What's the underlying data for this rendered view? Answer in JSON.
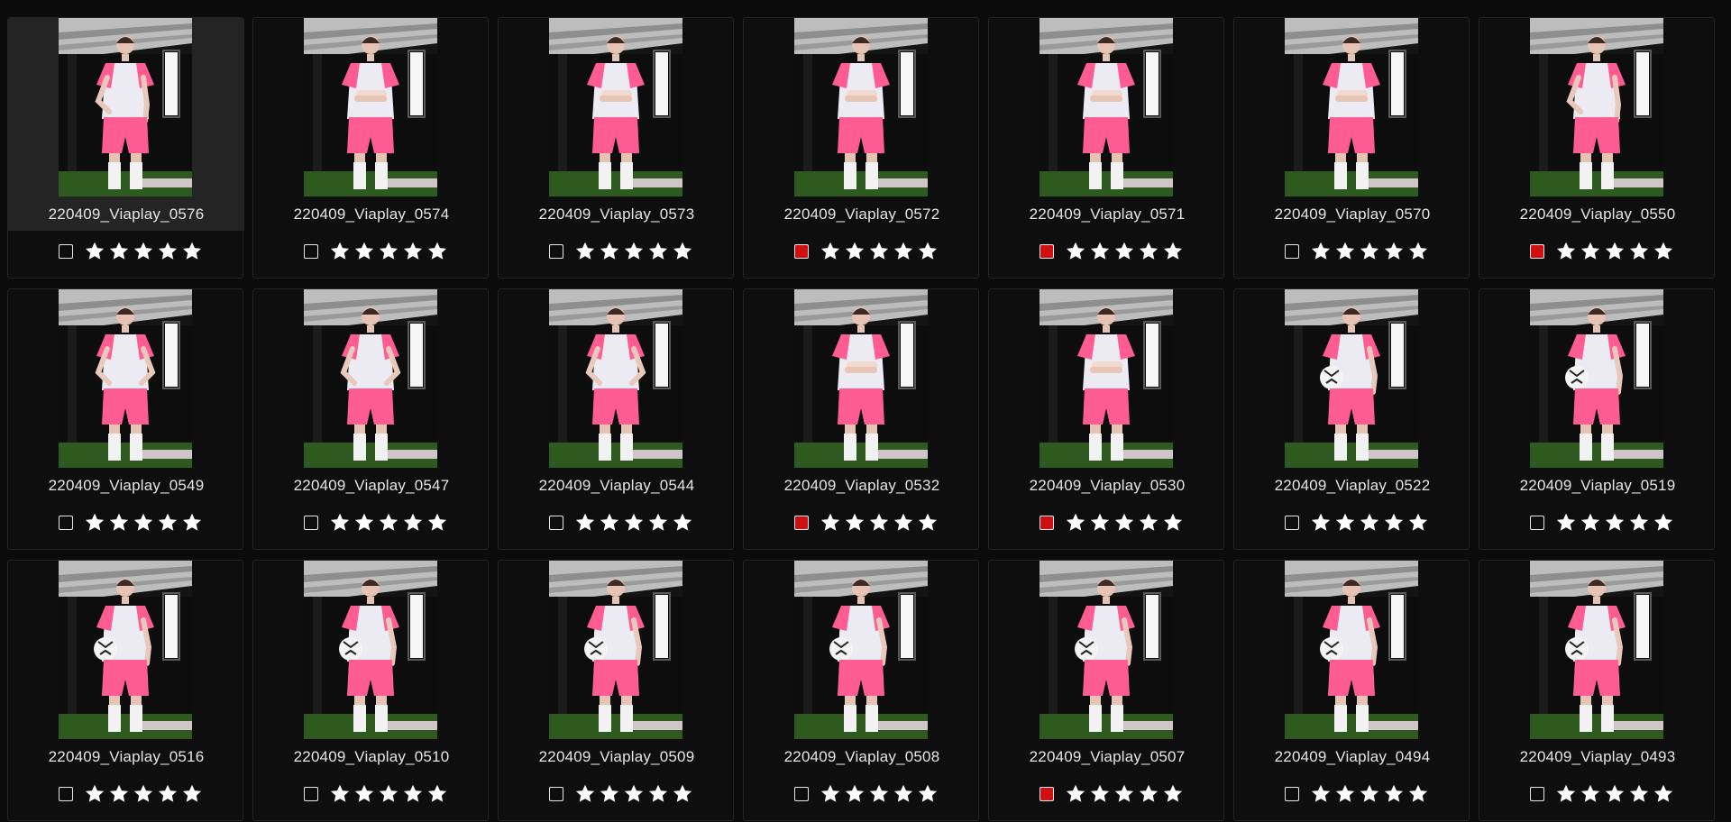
{
  "colors": {
    "background": "#0b0b0b",
    "card": "#0e0e0e",
    "selected_card": "#242424",
    "flag_red": "#cf1010",
    "star": "#ffffff",
    "text": "#e6e6e6"
  },
  "icons": {
    "flag": "checkbox-flag-icon",
    "rating": "star-icon"
  },
  "gallery": {
    "photos": [
      {
        "name": "220409_Viaplay_0576",
        "flagged": false,
        "stars": 5,
        "selected": true,
        "pose": "hand-on-hip"
      },
      {
        "name": "220409_Viaplay_0574",
        "flagged": false,
        "stars": 5,
        "selected": false,
        "pose": "arms-crossed"
      },
      {
        "name": "220409_Viaplay_0573",
        "flagged": false,
        "stars": 5,
        "selected": false,
        "pose": "arms-crossed"
      },
      {
        "name": "220409_Viaplay_0572",
        "flagged": true,
        "stars": 5,
        "selected": false,
        "pose": "arms-crossed"
      },
      {
        "name": "220409_Viaplay_0571",
        "flagged": true,
        "stars": 5,
        "selected": false,
        "pose": "arms-crossed"
      },
      {
        "name": "220409_Viaplay_0570",
        "flagged": false,
        "stars": 5,
        "selected": false,
        "pose": "arms-crossed"
      },
      {
        "name": "220409_Viaplay_0550",
        "flagged": true,
        "stars": 5,
        "selected": false,
        "pose": "hand-on-hip"
      },
      {
        "name": "220409_Viaplay_0549",
        "flagged": false,
        "stars": 5,
        "selected": false,
        "pose": "hands-on-hips"
      },
      {
        "name": "220409_Viaplay_0547",
        "flagged": false,
        "stars": 5,
        "selected": false,
        "pose": "hands-on-hips"
      },
      {
        "name": "220409_Viaplay_0544",
        "flagged": false,
        "stars": 5,
        "selected": false,
        "pose": "hands-on-hips"
      },
      {
        "name": "220409_Viaplay_0532",
        "flagged": true,
        "stars": 5,
        "selected": false,
        "pose": "arms-crossed"
      },
      {
        "name": "220409_Viaplay_0530",
        "flagged": true,
        "stars": 5,
        "selected": false,
        "pose": "arms-crossed"
      },
      {
        "name": "220409_Viaplay_0522",
        "flagged": false,
        "stars": 5,
        "selected": false,
        "pose": "holding-ball"
      },
      {
        "name": "220409_Viaplay_0519",
        "flagged": false,
        "stars": 5,
        "selected": false,
        "pose": "holding-ball"
      },
      {
        "name": "220409_Viaplay_0516",
        "flagged": false,
        "stars": 5,
        "selected": false,
        "pose": "holding-ball"
      },
      {
        "name": "220409_Viaplay_0510",
        "flagged": false,
        "stars": 5,
        "selected": false,
        "pose": "holding-ball"
      },
      {
        "name": "220409_Viaplay_0509",
        "flagged": false,
        "stars": 5,
        "selected": false,
        "pose": "holding-ball"
      },
      {
        "name": "220409_Viaplay_0508",
        "flagged": false,
        "stars": 5,
        "selected": false,
        "pose": "holding-ball"
      },
      {
        "name": "220409_Viaplay_0507",
        "flagged": true,
        "stars": 5,
        "selected": false,
        "pose": "holding-ball"
      },
      {
        "name": "220409_Viaplay_0494",
        "flagged": false,
        "stars": 5,
        "selected": false,
        "pose": "holding-ball"
      },
      {
        "name": "220409_Viaplay_0493",
        "flagged": false,
        "stars": 5,
        "selected": false,
        "pose": "holding-ball"
      }
    ]
  }
}
